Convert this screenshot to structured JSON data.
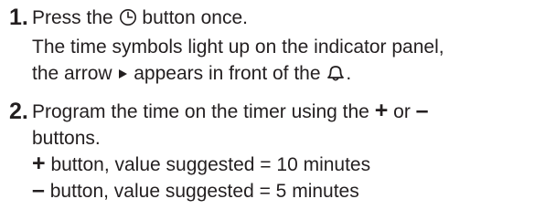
{
  "steps": [
    {
      "number": "1.",
      "lines": {
        "l1_pre": "Press the",
        "l1_post": "button once.",
        "l2": "The time symbols light up on the indicator panel,",
        "l3_pre": "the arrow",
        "l3_mid": "appears in front of the",
        "l3_post": "."
      },
      "icons": [
        "clock-icon",
        "arrow-right-icon",
        "bell-icon"
      ]
    },
    {
      "number": "2.",
      "lines": {
        "l1_pre": "Program the time on the timer using the",
        "plus": "+",
        "l1_or": "or",
        "minus": "–",
        "l2": "buttons.",
        "l3_sign": "+",
        "l3_text": "button, value suggested = 10 minutes",
        "l4_sign": "–",
        "l4_text": "button, value suggested = 5 minutes"
      }
    }
  ]
}
